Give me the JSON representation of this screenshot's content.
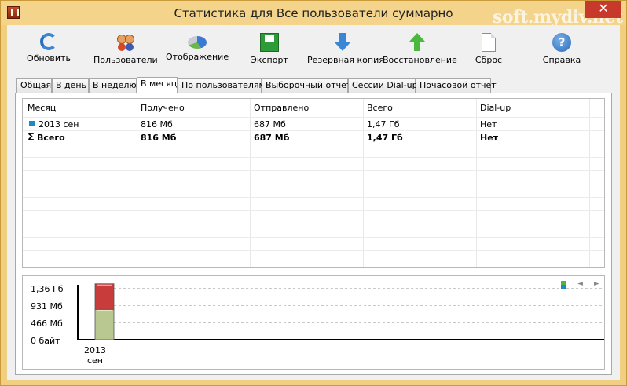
{
  "window": {
    "title": "Статистика для Все пользователи суммарно",
    "watermark": "soft.mydiv.net",
    "close_glyph": "✕"
  },
  "toolbar": [
    {
      "label": "Обновить",
      "icon": "refresh-icon"
    },
    {
      "label": "Пользователи",
      "icon": "users-icon"
    },
    {
      "label": "Отображение",
      "icon": "pie-chart-icon"
    },
    {
      "label": "Экспорт",
      "icon": "export-icon"
    },
    {
      "label": "Резервная копия",
      "icon": "backup-arrow-down-icon"
    },
    {
      "label": "Восстановление",
      "icon": "restore-arrow-up-icon"
    },
    {
      "label": "Сброс",
      "icon": "reset-document-icon"
    },
    {
      "label": "Справка",
      "icon": "help-icon",
      "glyph": "?"
    }
  ],
  "tabs": [
    {
      "label": "Общая"
    },
    {
      "label": "В день"
    },
    {
      "label": "В неделю"
    },
    {
      "label": "В месяц",
      "active": true
    },
    {
      "label": "По пользователям"
    },
    {
      "label": "Выборочный отчет"
    },
    {
      "label": "Сессии Dial-up"
    },
    {
      "label": "Почасовой отчет"
    }
  ],
  "table": {
    "columns": [
      "Месяц",
      "Получено",
      "Отправлено",
      "Всего",
      "Dial-up"
    ],
    "rows": [
      {
        "month": "2013 сен",
        "received": "816 Мб",
        "sent": "687 Мб",
        "total": "1,47 Гб",
        "dialup": "Нет"
      }
    ],
    "total_row": {
      "month": "Всего",
      "received": "816 Мб",
      "sent": "687 Мб",
      "total": "1,47 Гб",
      "dialup": "Нет",
      "glyph": "Σ"
    }
  },
  "chart_data": {
    "type": "bar",
    "stacked": true,
    "categories": [
      "2013 сен"
    ],
    "series": [
      {
        "values": [
          816
        ],
        "color": "#b8c890"
      },
      {
        "values": [
          687
        ],
        "color": "#c83c3c"
      }
    ],
    "y_ticks": [
      "1,36 Гб",
      "931 Мб",
      "466 Мб",
      "0 байт"
    ],
    "y_tick_values": [
      1392,
      931,
      466,
      0
    ],
    "ylim": [
      0,
      1392
    ],
    "x_tick_lines": [
      "2013",
      "сен"
    ],
    "grid": true,
    "nav": {
      "prev": "◄",
      "next": "►"
    }
  }
}
